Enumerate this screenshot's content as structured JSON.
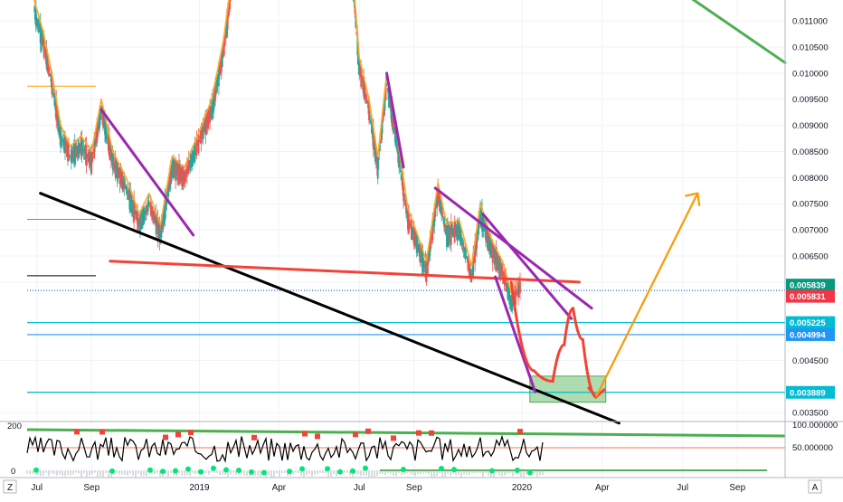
{
  "chart_data": {
    "type": "line",
    "symbol_hint": "crypto pair, daily candlesticks with moving average and trend drawings",
    "x_ticks": [
      "Jul",
      "Sep",
      "2019",
      "Apr",
      "Jul",
      "Sep",
      "2020",
      "Apr",
      "Jul",
      "Sep"
    ],
    "x_tick_dates": [
      "2018-07-01",
      "2018-09-01",
      "2019-01-01",
      "2019-04-01",
      "2019-07-01",
      "2019-09-01",
      "2020-01-01",
      "2020-04-01",
      "2020-07-01",
      "2020-09-01"
    ],
    "x_range": [
      "2018-06-20",
      "2020-10-25"
    ],
    "y_ticks": [
      "0.011000",
      "0.010500",
      "0.010000",
      "0.009500",
      "0.009000",
      "0.008500",
      "0.008000",
      "0.007500",
      "0.007000",
      "0.006500",
      "0.006000",
      "0.004500",
      "0.003500"
    ],
    "y_range": [
      0.0034,
      0.0114
    ],
    "price_series": {
      "name": "",
      "points": [
        [
          "2018-06-28",
          0.0112
        ],
        [
          "2018-07-08",
          0.0106
        ],
        [
          "2018-07-18",
          0.0098
        ],
        [
          "2018-07-28",
          0.0088
        ],
        [
          "2018-08-08",
          0.0084
        ],
        [
          "2018-08-20",
          0.0086
        ],
        [
          "2018-09-01",
          0.0083
        ],
        [
          "2018-09-12",
          0.0093
        ],
        [
          "2018-09-25",
          0.0083
        ],
        [
          "2018-10-10",
          0.0078
        ],
        [
          "2018-10-25",
          0.0071
        ],
        [
          "2018-11-05",
          0.0075
        ],
        [
          "2018-11-18",
          0.0069
        ],
        [
          "2018-12-01",
          0.0082
        ],
        [
          "2018-12-15",
          0.008
        ],
        [
          "2019-01-01",
          0.0087
        ],
        [
          "2019-01-15",
          0.0093
        ],
        [
          "2019-01-28",
          0.0104
        ],
        [
          "2019-02-08",
          0.0118
        ]
      ]
    },
    "price_series_2": {
      "name": "",
      "points": [
        [
          "2019-06-22",
          0.0121
        ],
        [
          "2019-07-01",
          0.0101
        ],
        [
          "2019-07-12",
          0.0093
        ],
        [
          "2019-07-22",
          0.0082
        ],
        [
          "2019-08-01",
          0.0098
        ],
        [
          "2019-08-12",
          0.0087
        ],
        [
          "2019-08-25",
          0.0072
        ],
        [
          "2019-09-05",
          0.0067
        ],
        [
          "2019-09-15",
          0.0062
        ],
        [
          "2019-09-28",
          0.0077
        ],
        [
          "2019-10-08",
          0.0069
        ],
        [
          "2019-10-22",
          0.007
        ],
        [
          "2019-11-05",
          0.0061
        ],
        [
          "2019-11-15",
          0.0073
        ],
        [
          "2019-11-28",
          0.0066
        ],
        [
          "2019-12-10",
          0.0062
        ],
        [
          "2019-12-20",
          0.0056
        ],
        [
          "2019-12-30",
          0.0059
        ]
      ]
    },
    "price_labels": [
      {
        "text": "0.005839",
        "value": 0.005839,
        "color": "#089981"
      },
      {
        "text": "0.005831",
        "value": 0.005831,
        "color": "#f23645"
      },
      {
        "text": "0.005225",
        "value": 0.005225,
        "color": "#00bcd4"
      },
      {
        "text": "0.004994",
        "value": 0.004994,
        "color": "#2196f3"
      },
      {
        "text": "0.003889",
        "value": 0.003889,
        "color": "#00bcd4"
      }
    ],
    "horizontal_lines": [
      {
        "value": 0.005839,
        "color": "#2962ff",
        "style": "dotted"
      },
      {
        "value": 0.005225,
        "color": "#00bcd4",
        "style": "solid"
      },
      {
        "value": 0.004994,
        "color": "#2196f3",
        "style": "solid"
      },
      {
        "value": 0.003889,
        "color": "#00bcd4",
        "style": "solid"
      }
    ],
    "trendlines": [
      {
        "color": "#9c27b0",
        "from": [
          "2018-09-12",
          0.0093
        ],
        "to": [
          "2018-12-25",
          0.0069
        ]
      },
      {
        "color": "#000000",
        "from": [
          "2018-07-05",
          0.0077
        ],
        "to": [
          "2020-04-20",
          0.0033
        ]
      },
      {
        "color": "#f44336",
        "from": [
          "2018-09-22",
          0.0064
        ],
        "to": [
          "2020-03-06",
          0.006
        ]
      },
      {
        "color": "#9c27b0",
        "from": [
          "2019-08-01",
          0.01
        ],
        "to": [
          "2019-08-20",
          0.0082
        ]
      },
      {
        "color": "#9c27b0",
        "from": [
          "2019-09-25",
          0.0078
        ],
        "to": [
          "2020-03-20",
          0.0055
        ]
      },
      {
        "color": "#9c27b0",
        "from": [
          "2019-11-18",
          0.0073
        ],
        "to": [
          "2020-02-26",
          0.0053
        ]
      },
      {
        "color": "#9c27b0",
        "from": [
          "2019-12-02",
          0.0061
        ],
        "to": [
          "2020-01-16",
          0.0039
        ]
      },
      {
        "color": "#4caf50",
        "from": [
          "2020-07-05",
          0.0115
        ],
        "to": [
          "2020-10-25",
          0.0102
        ]
      }
    ],
    "projection_path": {
      "color": "#f44336",
      "points": [
        [
          "2019-12-20",
          0.006
        ],
        [
          "2020-01-15",
          0.0043
        ],
        [
          "2020-02-05",
          0.0041
        ],
        [
          "2020-02-18",
          0.0048
        ],
        [
          "2020-02-28",
          0.0055
        ],
        [
          "2020-03-10",
          0.0049
        ],
        [
          "2020-03-25",
          0.0038
        ]
      ]
    },
    "projection_arrow": {
      "color": "#ff9800",
      "from": [
        "2020-03-25",
        0.0038
      ],
      "to": [
        "2020-07-18",
        0.0077
      ]
    },
    "target_zone": {
      "color": "#4caf50",
      "x": [
        "2020-01-10",
        "2020-04-05"
      ],
      "y": [
        0.0037,
        0.0042
      ]
    },
    "indicator": {
      "left_ticks": [
        "200",
        "0"
      ],
      "right_ticks": [
        "100.000000",
        "50.000000"
      ]
    },
    "footer": {
      "left_button": "Z",
      "right_button": "A"
    }
  }
}
